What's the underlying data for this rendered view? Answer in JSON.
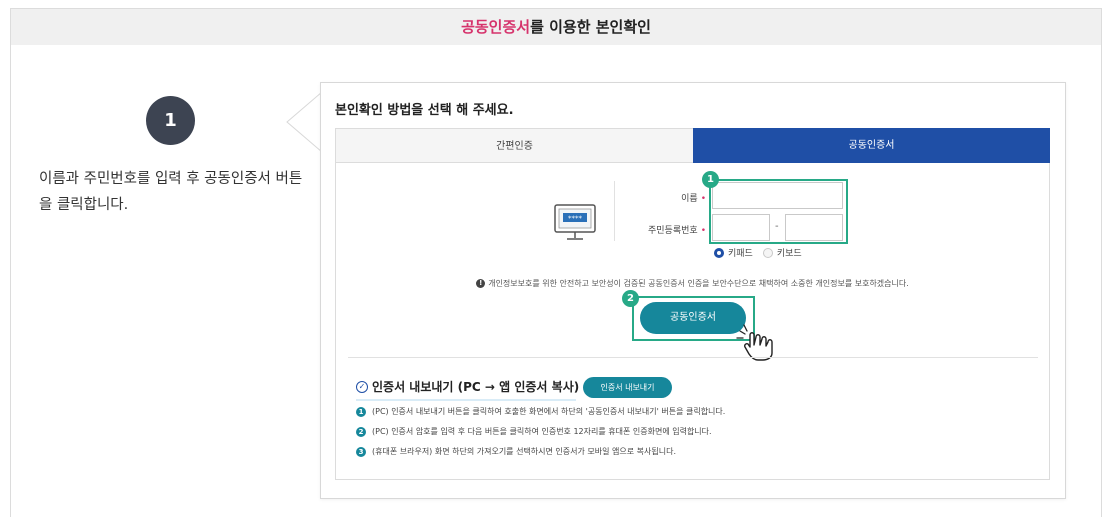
{
  "header": {
    "title_highlight": "공동인증서",
    "title_rest": "를 이용한 본인확인"
  },
  "step": {
    "number": "1",
    "description": "이름과 주민번호를 입력 후 공동인증서 버튼을 클릭합니다."
  },
  "panel": {
    "title": "본인확인 방법을 선택 해 주세요.",
    "tabs": [
      {
        "label": "간편인증",
        "active": false
      },
      {
        "label": "공동인증서",
        "active": true
      }
    ],
    "form": {
      "name_label": "이름",
      "rrn_label": "주민등록번호",
      "required_mark": "•",
      "name_value": "",
      "rrn_front_value": "",
      "rrn_back_value": "",
      "rrn_separator": "-",
      "keypad_options": [
        {
          "label": "키패드",
          "selected": true
        },
        {
          "label": "키보드",
          "selected": false
        }
      ]
    },
    "callouts": [
      "1",
      "2"
    ],
    "notice_icon": "!",
    "notice": "개인정보보호를 위한 안전하고 보안성이 검증된 공동인증서 인증을 보안수단으로 채택하여 소중한 개인정보를 보호하겠습니다.",
    "cert_button_label": "공동인증서",
    "monitor_screen_text": "****",
    "export": {
      "title": "인증서 내보내기 (PC → 앱 인증서 복사)",
      "button_label": "인증서 내보내기",
      "steps": [
        {
          "num": "1",
          "text": "(PC) 인증서 내보내기 버튼을 클릭하여 호출한 화면에서 하단의 '공동인증서 내보내기' 버튼을 클릭합니다."
        },
        {
          "num": "2",
          "text": "(PC) 인증서 암호를 입력 후 다음 버튼을 클릭하여 인증번호 12자리를 휴대폰 인증화면에 입력합니다."
        },
        {
          "num": "3",
          "text": "(휴대폰 브라우저) 화면 하단의 가져오기를 선택하시면 인증서가 모바일 앱으로 복사됩니다."
        }
      ]
    }
  },
  "colors": {
    "accent_pink": "#d6336c",
    "tab_active_blue": "#1f4fa6",
    "teal_button": "#16879b",
    "callout_green": "#27a987",
    "step_circle": "#3d4452"
  }
}
